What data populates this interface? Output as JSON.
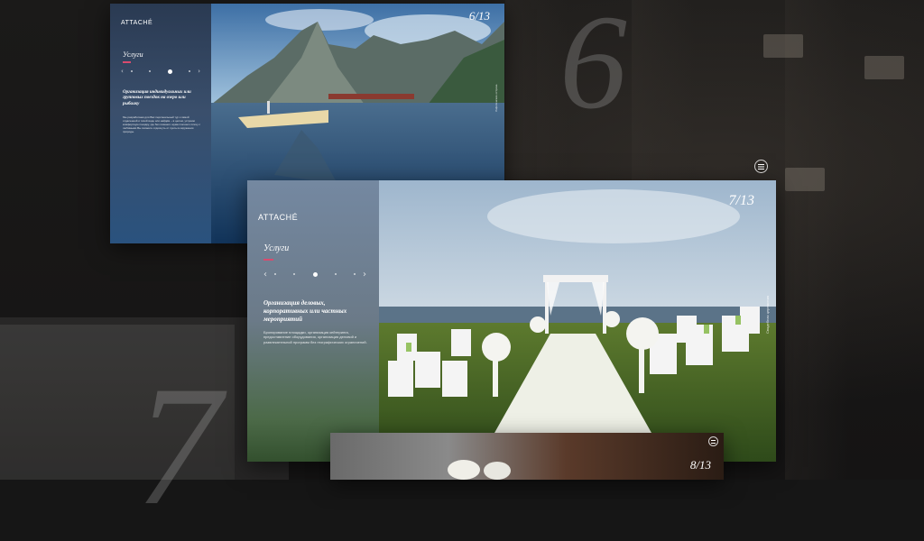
{
  "background": {
    "big_number_top": "6",
    "big_number_bottom": "7"
  },
  "slides": [
    {
      "logo_small": "",
      "logo": "ATTACHÉ",
      "section_title": "Услуги",
      "heading": "Организация индивидуальных или групповых поездок на озеро или рыбалку",
      "body": "Мы разработаем для Вас персональный тур к самой отдаленной и тихой воде или найдём – в целом, устроим комфортную поездку, где без лишнего шума плечом к плечу с любимыми Вы сможете отдохнуть от суеты в окружении природы.",
      "counter": "6/13",
      "side_caption": "Лофотенские острова"
    },
    {
      "logo_small": "",
      "logo": "ATTACHÉ",
      "section_title": "Услуги",
      "heading": "Организация деловых, корпоративных или частных мероприятий",
      "body": "Бронирование площадки, организация кейтеринга, предоставление оборудования, организация деловой и развлекательной программ без географических ограничений.",
      "counter": "7/13",
      "side_caption": "Свадебная церемония"
    },
    {
      "counter": "8/13"
    }
  ],
  "colors": {
    "accent": "#d84b6e"
  },
  "icons": {
    "prev": "chevron-left-icon",
    "next": "chevron-right-icon",
    "menu": "menu-icon"
  }
}
